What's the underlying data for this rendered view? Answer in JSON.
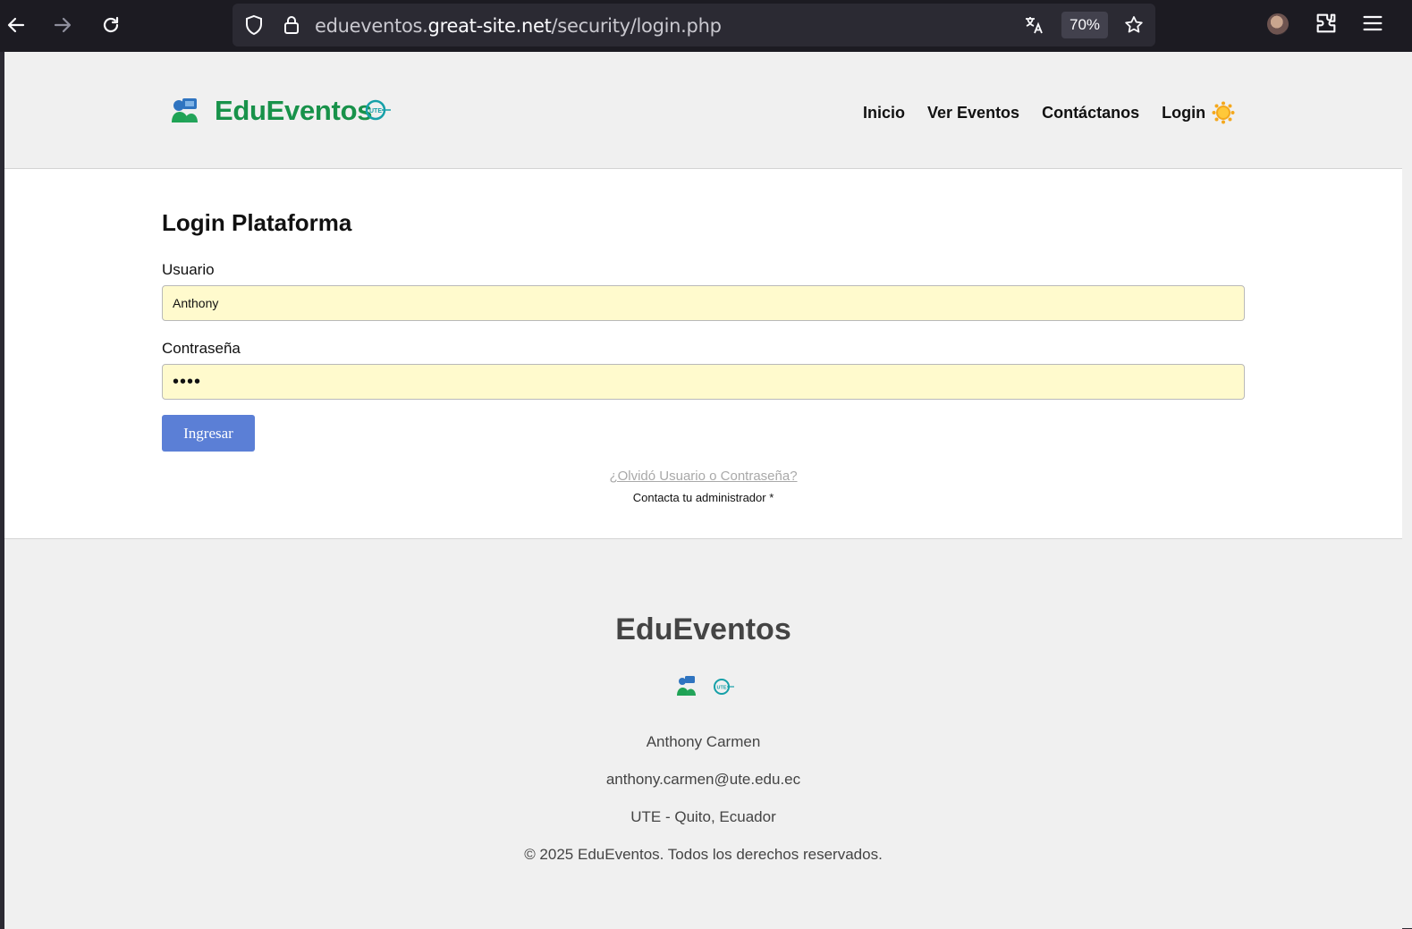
{
  "browser": {
    "url_prefix": "edueventos.",
    "url_host": "great-site.net",
    "url_path": "/security/login.php",
    "zoom": "70%"
  },
  "header": {
    "brand": "EduEventos",
    "nav": [
      "Inicio",
      "Ver Eventos",
      "Contáctanos",
      "Login"
    ]
  },
  "login": {
    "title": "Login Plataforma",
    "user_label": "Usuario",
    "user_value": "Anthony",
    "password_label": "Contraseña",
    "password_value": "••••",
    "submit_label": "Ingresar",
    "forgot_link": "¿Olvidó Usuario o Contraseña?",
    "admin_note": "Contacta tu administrador *"
  },
  "footer": {
    "brand": "EduEventos",
    "name": "Anthony Carmen",
    "email": "anthony.carmen@ute.edu.ec",
    "location": "UTE - Quito, Ecuador",
    "copyright": "© 2025 EduEventos. Todos los derechos reservados."
  },
  "colors": {
    "brand_green": "#18924a",
    "button_blue": "#5b7fd6",
    "autofill_yellow": "#fffacd"
  }
}
